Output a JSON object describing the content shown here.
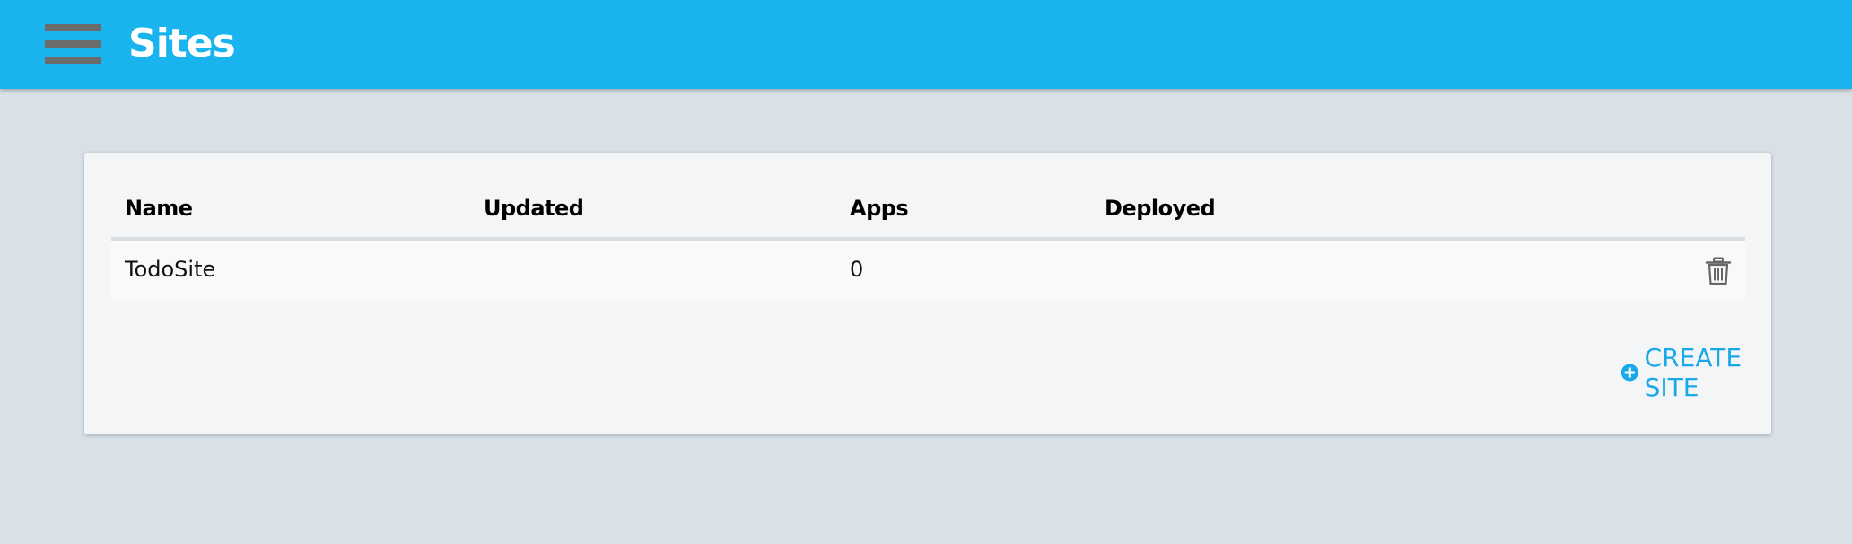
{
  "header": {
    "title": "Sites",
    "menu_icon": "hamburger-menu-icon",
    "background_color": "#19b3ee"
  },
  "table": {
    "columns": [
      "Name",
      "Updated",
      "Apps",
      "Deployed"
    ],
    "rows": [
      {
        "name": "TodoSite",
        "updated": "",
        "apps": "0",
        "deployed": ""
      }
    ],
    "row_action_icon": "trash-icon"
  },
  "actions": {
    "create_label": "CREATE SITE",
    "create_icon": "plus-circle-icon",
    "accent_color": "#19a9e8"
  }
}
